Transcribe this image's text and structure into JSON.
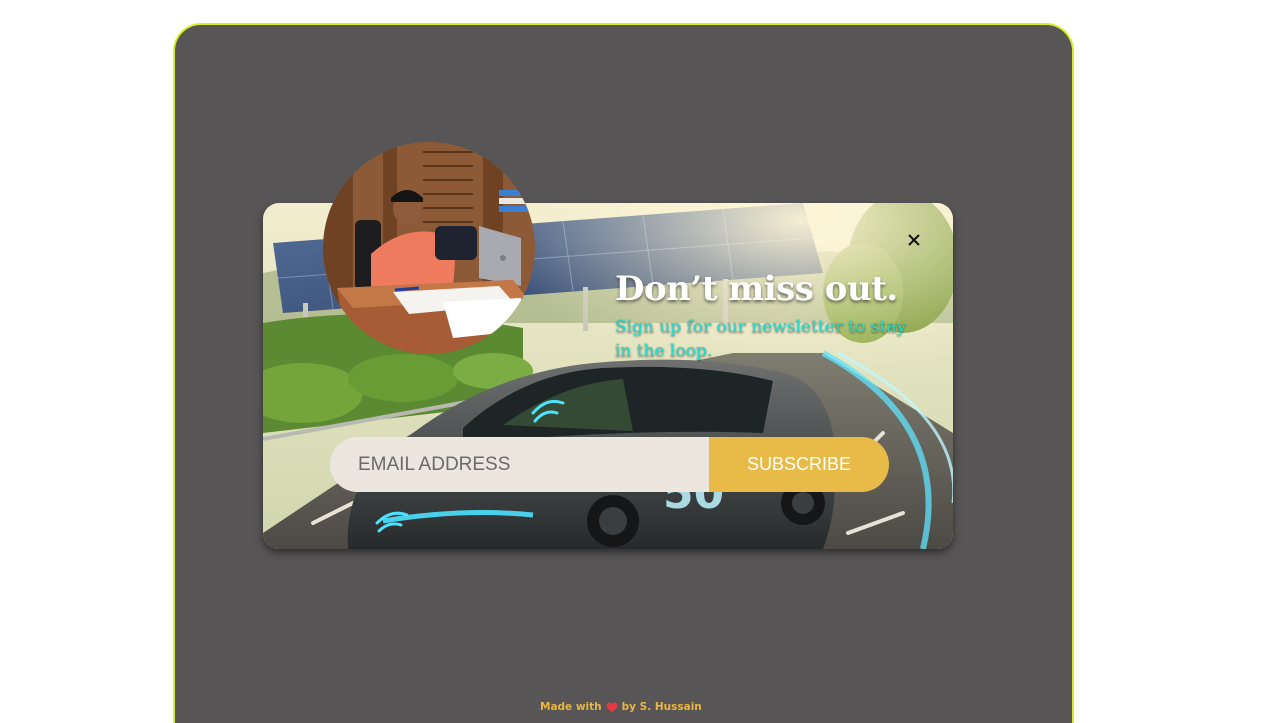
{
  "popup": {
    "headline": "Don’t miss out.",
    "subtext": "Sign up for our newsletter to stay in the loop.",
    "email_placeholder": "EMAIL ADDRESS",
    "subscribe_label": "SUBSCRIBE",
    "close_icon": "close-icon"
  },
  "footer": {
    "made_with": "Made with",
    "heart_icon": "heart-icon",
    "by_author": "by S. Hussain"
  },
  "colors": {
    "frame_background": "#575556",
    "frame_border": "#d9ec2a",
    "subtext": "#1be0d2",
    "subscribe_button": "#e8bb48",
    "email_field": "#ece6de",
    "footer_text": "#e9b640",
    "heart": "#e53945"
  }
}
